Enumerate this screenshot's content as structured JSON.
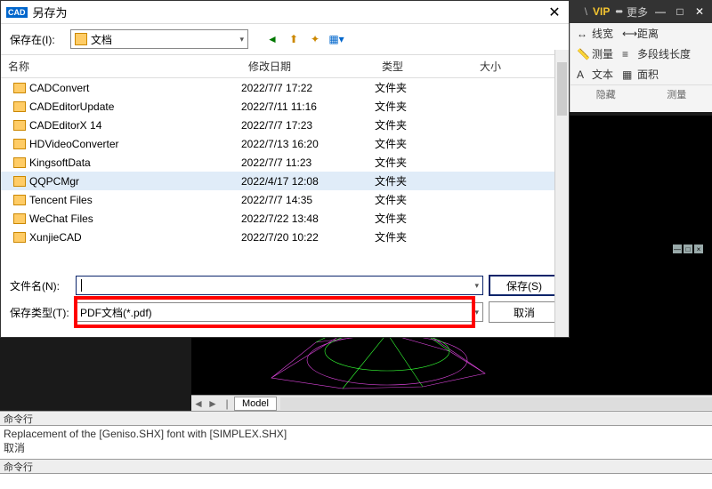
{
  "topbar": {
    "vip": "VIP",
    "more": "更多"
  },
  "ribbon": {
    "r1": [
      {
        "ico": "↔",
        "t": "线宽"
      },
      {
        "ico": "⟷",
        "t": "距离"
      }
    ],
    "r2": [
      {
        "ico": "📏",
        "t": "测量"
      },
      {
        "ico": "≡",
        "t": "多段线长度"
      }
    ],
    "r3": [
      {
        "ico": "A",
        "t": "文本"
      },
      {
        "ico": "▦",
        "t": "面积"
      }
    ],
    "lab1": "隐藏",
    "lab2": "测量"
  },
  "inner_win": [
    "—",
    "□",
    "×"
  ],
  "model_tab": {
    "left": "◄",
    "right": "►",
    "sep": "|",
    "tab": "Model"
  },
  "cmd": {
    "label": "命令行",
    "out1": "Replacement of the [Geniso.SHX] font with [SIMPLEX.SHX]",
    "out2": "取消"
  },
  "dialog": {
    "title": "另存为",
    "save_in": "保存在(I):",
    "path": "文档",
    "headers": {
      "name": "名称",
      "date": "修改日期",
      "type": "类型",
      "size": "大小"
    },
    "rows": [
      {
        "n": "CADConvert",
        "d": "2022/7/7 17:22",
        "t": "文件夹"
      },
      {
        "n": "CADEditorUpdate",
        "d": "2022/7/11 11:16",
        "t": "文件夹"
      },
      {
        "n": "CADEditorX 14",
        "d": "2022/7/7 17:23",
        "t": "文件夹"
      },
      {
        "n": "HDVideoConverter",
        "d": "2022/7/13 16:20",
        "t": "文件夹"
      },
      {
        "n": "KingsoftData",
        "d": "2022/7/7 11:23",
        "t": "文件夹"
      },
      {
        "n": "QQPCMgr",
        "d": "2022/4/17 12:08",
        "t": "文件夹",
        "sel": true
      },
      {
        "n": "Tencent Files",
        "d": "2022/7/7 14:35",
        "t": "文件夹"
      },
      {
        "n": "WeChat Files",
        "d": "2022/7/22 13:48",
        "t": "文件夹"
      },
      {
        "n": "XunjieCAD",
        "d": "2022/7/20 10:22",
        "t": "文件夹"
      }
    ],
    "filename_lbl": "文件名(N):",
    "filename_val": "",
    "filetype_lbl": "保存类型(T):",
    "filetype_val": "PDF文档(*.pdf)",
    "save_btn": "保存(S)",
    "cancel_btn": "取消"
  }
}
